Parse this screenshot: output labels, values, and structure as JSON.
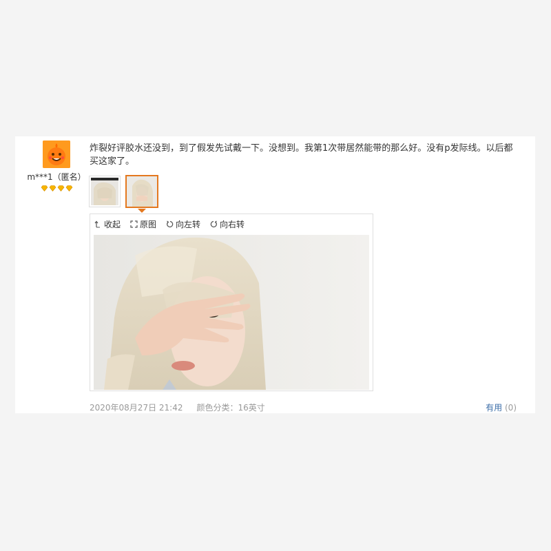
{
  "user": {
    "name": "m***1（匿名）",
    "avatar_icon": "cartoon-mascot-avatar",
    "vip_icon": "diamond-icon",
    "vip_level": 4,
    "accent": "#ff9a1e"
  },
  "review": {
    "text": "炸裂好评胶水还没到，到了假发先试戴一下。没想到。我第1次带居然能带的那么好。没有p发际线。以后都买这家了。"
  },
  "thumbnails": [
    {
      "name": "review-photo-1",
      "selected": false
    },
    {
      "name": "review-photo-2",
      "selected": true
    }
  ],
  "viewer": {
    "collapse_label": "收起",
    "original_label": "原图",
    "rotate_left_label": "向左转",
    "rotate_right_label": "向右转"
  },
  "meta": {
    "date": "2020年08月27日 21:42",
    "sku": "颜色分类：16英寸"
  },
  "useful": {
    "label": "有用",
    "count": "(0)"
  },
  "colors": {
    "selected_border": "#e4781e",
    "link": "#3c6ea8",
    "muted": "#999999"
  }
}
